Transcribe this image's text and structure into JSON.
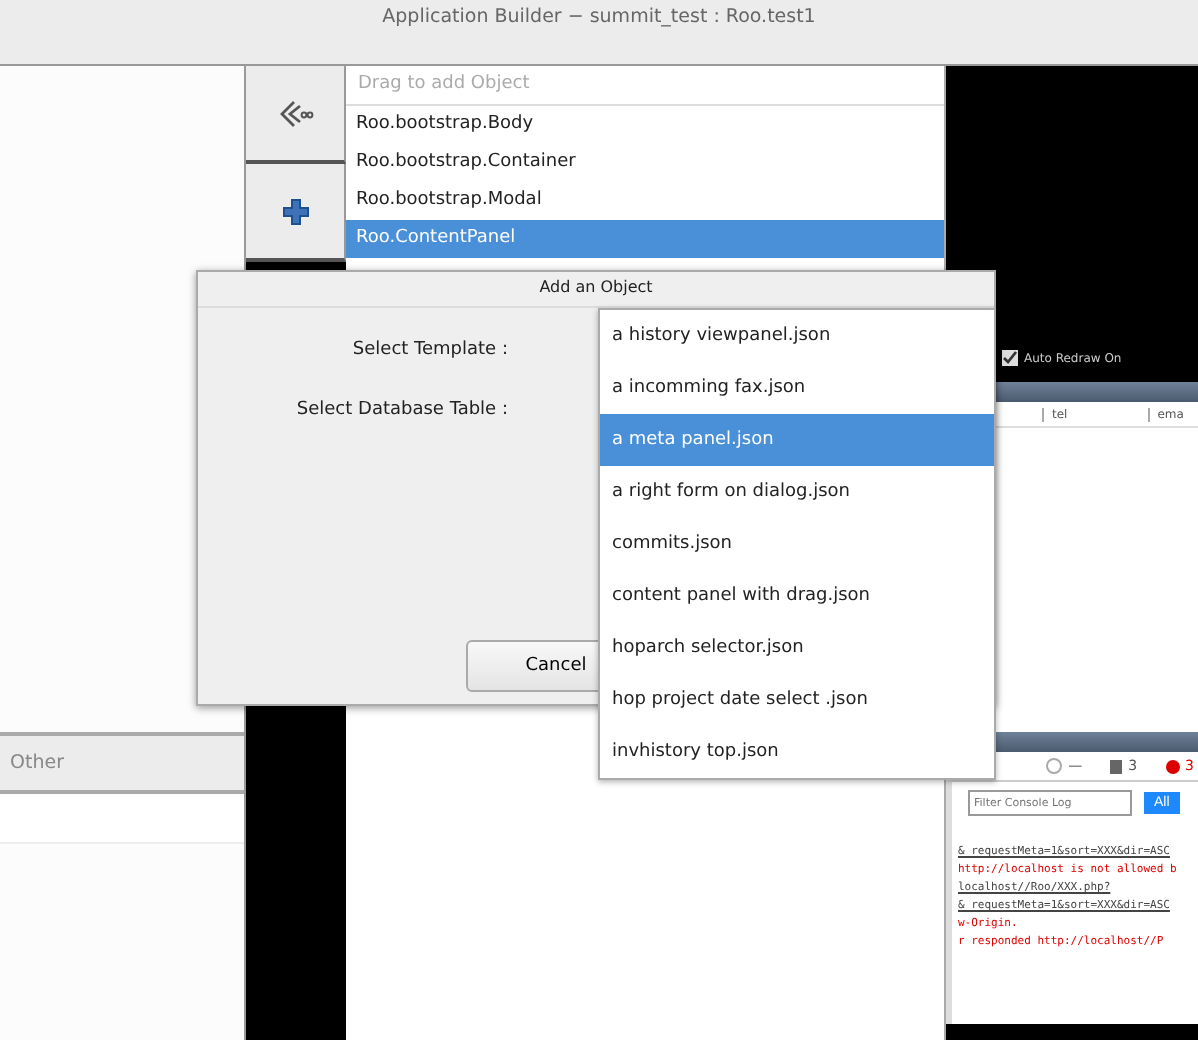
{
  "window": {
    "title": "Application Builder − summit_test : Roo.test1"
  },
  "object_palette": {
    "placeholder": "Drag to add Object",
    "items": [
      {
        "label": "Roo.bootstrap.Body",
        "selected": false
      },
      {
        "label": "Roo.bootstrap.Container",
        "selected": false
      },
      {
        "label": "Roo.bootstrap.Modal",
        "selected": false
      },
      {
        "label": "Roo.ContentPanel",
        "selected": true
      }
    ]
  },
  "left_panel": {
    "tab": "Other"
  },
  "preview": {
    "auto_redraw": {
      "label": "Auto Redraw On",
      "checked": true
    },
    "table_columns": [
      "tel",
      "ema"
    ],
    "console": {
      "counters": [
        {
          "kind": "timer",
          "text": "—"
        },
        {
          "kind": "warning",
          "text": "3"
        },
        {
          "kind": "error",
          "text": "3"
        }
      ],
      "filter_placeholder": "Filter Console Log",
      "filter_button": "All",
      "log_lines": [
        {
          "text": "&_requestMeta=1&sort=XXX&dir=ASC",
          "kind": "link"
        },
        {
          "text": "http://localhost is not allowed b",
          "kind": "error"
        },
        {
          "text": "localhost//Roo/XXX.php?",
          "kind": "link"
        },
        {
          "text": "&_requestMeta=1&sort=XXX&dir=ASC",
          "kind": "link"
        },
        {
          "text": "w-Origin.",
          "kind": "error"
        },
        {
          "text": "r responded  http://localhost//P",
          "kind": "error"
        }
      ]
    }
  },
  "dialog": {
    "title": "Add an Object",
    "fields": [
      {
        "label": "Select Template :"
      },
      {
        "label": "Select Database Table :"
      }
    ],
    "buttons": [
      "Cancel"
    ],
    "template_options": [
      {
        "label": "a history viewpanel.json",
        "selected": false
      },
      {
        "label": "a incomming fax.json",
        "selected": false
      },
      {
        "label": "a meta panel.json",
        "selected": true
      },
      {
        "label": "a right form on dialog.json",
        "selected": false
      },
      {
        "label": "commits.json",
        "selected": false
      },
      {
        "label": "content panel with drag.json",
        "selected": false
      },
      {
        "label": "hoparch selector.json",
        "selected": false
      },
      {
        "label": "hop project date select .json",
        "selected": false
      },
      {
        "label": "invhistory top.json",
        "selected": false
      }
    ]
  }
}
